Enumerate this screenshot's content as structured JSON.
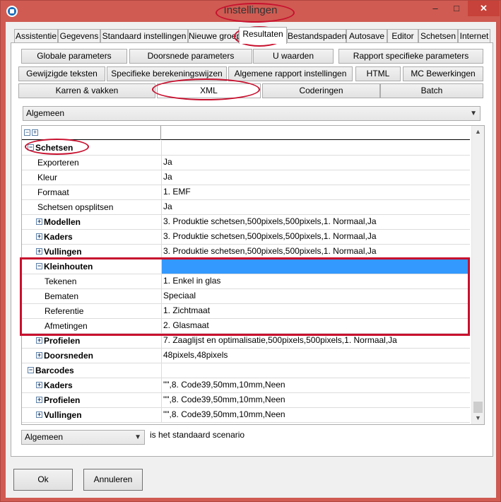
{
  "window": {
    "title": "Instellingen",
    "controls": {
      "minimize": "–",
      "maximize": "□",
      "close": "✕"
    }
  },
  "tabs": [
    {
      "label": "Assistentie"
    },
    {
      "label": "Gegevens"
    },
    {
      "label": "Standaard instellingen"
    },
    {
      "label": "Nieuwe groep"
    },
    {
      "label": "Resultaten",
      "active": true
    },
    {
      "label": "Bestandspaden"
    },
    {
      "label": "Autosave"
    },
    {
      "label": "Editor"
    },
    {
      "label": "Schetsen"
    },
    {
      "label": "Internet"
    }
  ],
  "subtabs": {
    "row1": [
      "Globale parameters",
      "Doorsnede parameters",
      "U waarden",
      "Rapport specifieke parameters"
    ],
    "row2": [
      "Gewijzigde teksten",
      "Specifieke berekeningswijzen",
      "Algemene rapport instellingen",
      "HTML",
      "MC Bewerkingen"
    ],
    "row3": [
      "Karren & vakken",
      "XML",
      "Coderingen",
      "Batch"
    ]
  },
  "category_select": {
    "value": "Algemeen"
  },
  "grid": {
    "rows": [
      {
        "name": "Schetsen",
        "value": "",
        "indent": 0,
        "expander": "−",
        "kind": "section"
      },
      {
        "name": "Exporteren",
        "value": "Ja",
        "indent": 1
      },
      {
        "name": "Kleur",
        "value": "Ja",
        "indent": 1
      },
      {
        "name": "Formaat",
        "value": "1. EMF",
        "indent": 1
      },
      {
        "name": "Schetsen opsplitsen",
        "value": "Ja",
        "indent": 1
      },
      {
        "name": "Modellen",
        "value": "3. Produktie schetsen,500pixels,500pixels,1. Normaal,Ja",
        "indent": 1,
        "expander": "+",
        "kind": "group"
      },
      {
        "name": "Kaders",
        "value": "3. Produktie schetsen,500pixels,500pixels,1. Normaal,Ja",
        "indent": 1,
        "expander": "+",
        "kind": "group"
      },
      {
        "name": "Vullingen",
        "value": "3. Produktie schetsen,500pixels,500pixels,1. Normaal,Ja",
        "indent": 1,
        "expander": "+",
        "kind": "group"
      },
      {
        "name": "Kleinhouten",
        "value": "",
        "indent": 1,
        "expander": "−",
        "kind": "group",
        "selected": true
      },
      {
        "name": "Tekenen",
        "value": "1. Enkel in glas",
        "indent": 2
      },
      {
        "name": "Bematen",
        "value": "Speciaal",
        "indent": 2
      },
      {
        "name": "Referentie",
        "value": "1. Zichtmaat",
        "indent": 2
      },
      {
        "name": "Afmetingen",
        "value": "2. Glasmaat",
        "indent": 2
      },
      {
        "name": "Profielen",
        "value": "7. Zaaglijst en optimalisatie,500pixels,500pixels,1. Normaal,Ja",
        "indent": 1,
        "expander": "+",
        "kind": "group"
      },
      {
        "name": "Doorsneden",
        "value": "48pixels,48pixels",
        "indent": 1,
        "expander": "+",
        "kind": "group"
      },
      {
        "name": "Barcodes",
        "value": "",
        "indent": 0,
        "expander": "−",
        "kind": "section"
      },
      {
        "name": "Kaders",
        "value": "\"\",8. Code39,50mm,10mm,Neen",
        "indent": 1,
        "expander": "+",
        "kind": "group"
      },
      {
        "name": "Profielen",
        "value": "\"\",8. Code39,50mm,10mm,Neen",
        "indent": 1,
        "expander": "+",
        "kind": "group"
      },
      {
        "name": "Vullingen",
        "value": "\"\",8. Code39,50mm,10mm,Neen",
        "indent": 1,
        "expander": "+",
        "kind": "group"
      }
    ]
  },
  "scenario": {
    "value": "Algemeen",
    "label": "is het standaard scenario"
  },
  "footer": {
    "ok": "Ok",
    "cancel": "Annuleren"
  },
  "colors": {
    "titlebar": "#cf5b52",
    "selection": "#3399ff",
    "annotation": "#c8102e"
  }
}
